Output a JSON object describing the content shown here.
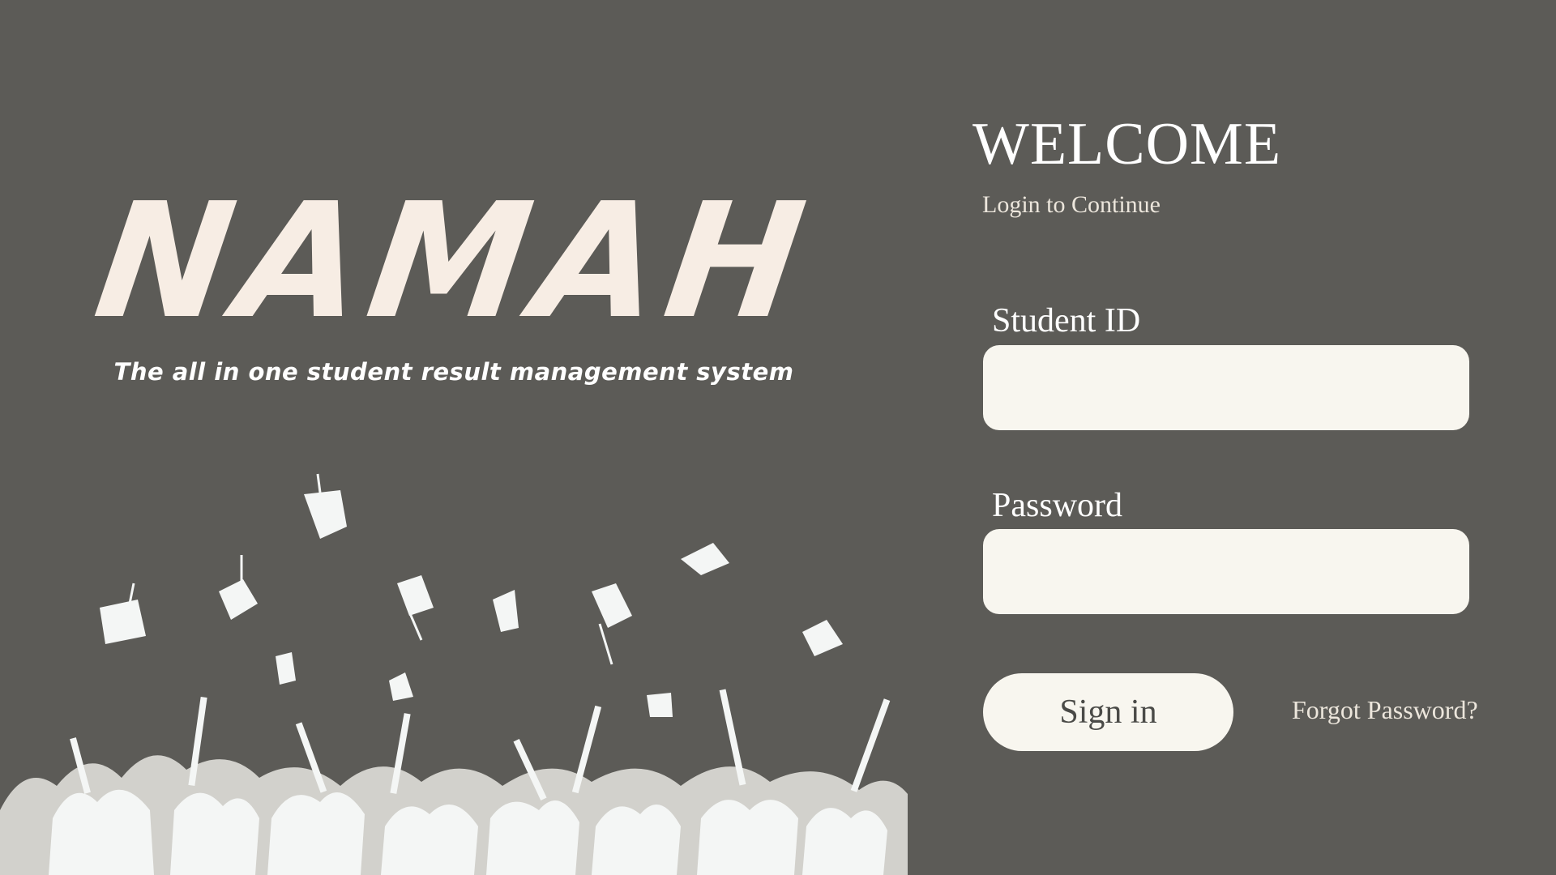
{
  "brand": {
    "title": "NAMAH",
    "tagline": "The all in one student result management system",
    "illustration": "graduates-throwing-caps-silhouette"
  },
  "login": {
    "heading": "WELCOME",
    "subtitle": "Login to Continue",
    "student_id_label": "Student ID",
    "student_id_value": "",
    "password_label": "Password",
    "password_value": "",
    "signin_label": "Sign in",
    "forgot_label": "Forgot Password?"
  },
  "colors": {
    "background": "#5c5b57",
    "brand_text": "#f7ede4",
    "input_fill": "#f8f6ef",
    "silhouette_front": "#f4f6f5",
    "silhouette_back": "#d2d1cc"
  }
}
